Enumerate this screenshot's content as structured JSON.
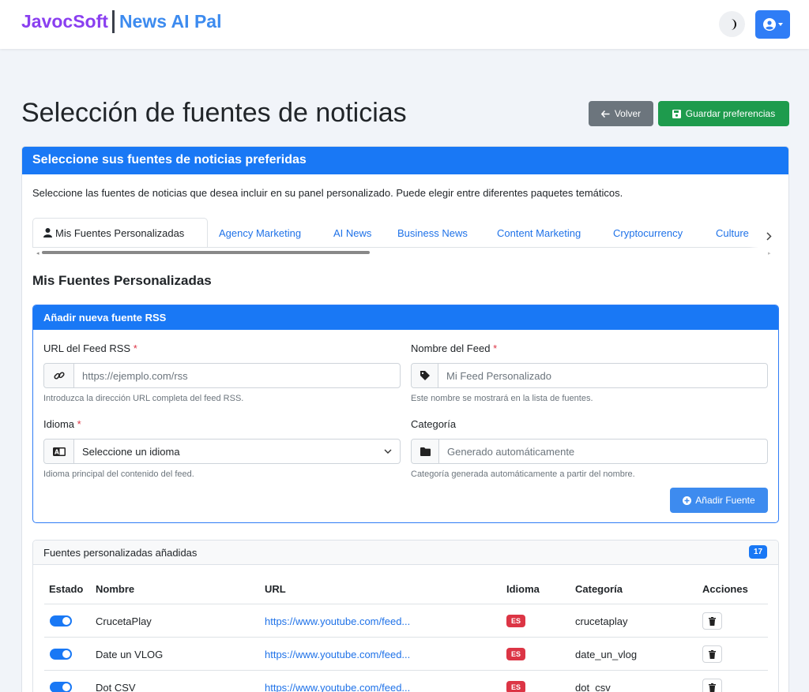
{
  "navbar": {
    "brand_primary": "JavocSoft",
    "brand_secondary": "News AI Pal"
  },
  "header": {
    "title": "Selección de fuentes de noticias",
    "back_label": "Volver",
    "save_label": "Guardar preferencias"
  },
  "card": {
    "title": "Seleccione sus fuentes de noticias preferidas",
    "description": "Seleccione las fuentes de noticias que desea incluir en su panel personalizado. Puede elegir entre diferentes paquetes temáticos."
  },
  "tabs": [
    {
      "label": "Mis Fuentes Personalizadas",
      "active": true
    },
    {
      "label": "Agency Marketing",
      "active": false
    },
    {
      "label": "AI News",
      "active": false
    },
    {
      "label": "Business News",
      "active": false
    },
    {
      "label": "Content Marketing",
      "active": false
    },
    {
      "label": "Cryptocurrency",
      "active": false
    },
    {
      "label": "Culture",
      "active": false
    }
  ],
  "section_title": "Mis Fuentes Personalizadas",
  "add_form": {
    "title": "Añadir nueva fuente RSS",
    "url_label": "URL del Feed RSS",
    "url_placeholder": "https://ejemplo.com/rss",
    "url_help": "Introduzca la dirección URL completa del feed RSS.",
    "name_label": "Nombre del Feed",
    "name_placeholder": "Mi Feed Personalizado",
    "name_help": "Este nombre se mostrará en la lista de fuentes.",
    "lang_label": "Idioma",
    "lang_selected": "Seleccione un idioma",
    "lang_help": "Idioma principal del contenido del feed.",
    "cat_label": "Categoría",
    "cat_placeholder": "Generado automáticamente",
    "cat_help": "Categoría generada automáticamente a partir del nombre.",
    "required_mark": "*",
    "add_label": "Añadir Fuente"
  },
  "list": {
    "title": "Fuentes personalizadas añadidas",
    "count": "17",
    "columns": {
      "estado": "Estado",
      "nombre": "Nombre",
      "url": "URL",
      "idioma": "Idioma",
      "categoria": "Categoría",
      "acciones": "Acciones"
    },
    "rows": [
      {
        "name": "CrucetaPlay",
        "url": "https://www.youtube.com/feed...",
        "lang": "ES",
        "category": "crucetaplay"
      },
      {
        "name": "Date un VLOG",
        "url": "https://www.youtube.com/feed...",
        "lang": "ES",
        "category": "date_un_vlog"
      },
      {
        "name": "Dot CSV",
        "url": "https://www.youtube.com/feed...",
        "lang": "ES",
        "category": "dot_csv"
      }
    ]
  },
  "colors": {
    "primary": "#1978f5",
    "success": "#1e9b4d",
    "secondary": "#6c757d",
    "danger": "#dc3545",
    "brand_purple": "#8a3ff0"
  },
  "icons": {
    "theme": "moon-icon",
    "user": "user-circle-icon",
    "back": "arrow-left-icon",
    "save": "floppy-disk-icon",
    "tab_active": "user-icon",
    "url": "link-icon",
    "name": "tag-icon",
    "lang": "language-icon",
    "category": "folder-icon",
    "add": "plus-circle-icon",
    "delete": "trash-icon"
  }
}
